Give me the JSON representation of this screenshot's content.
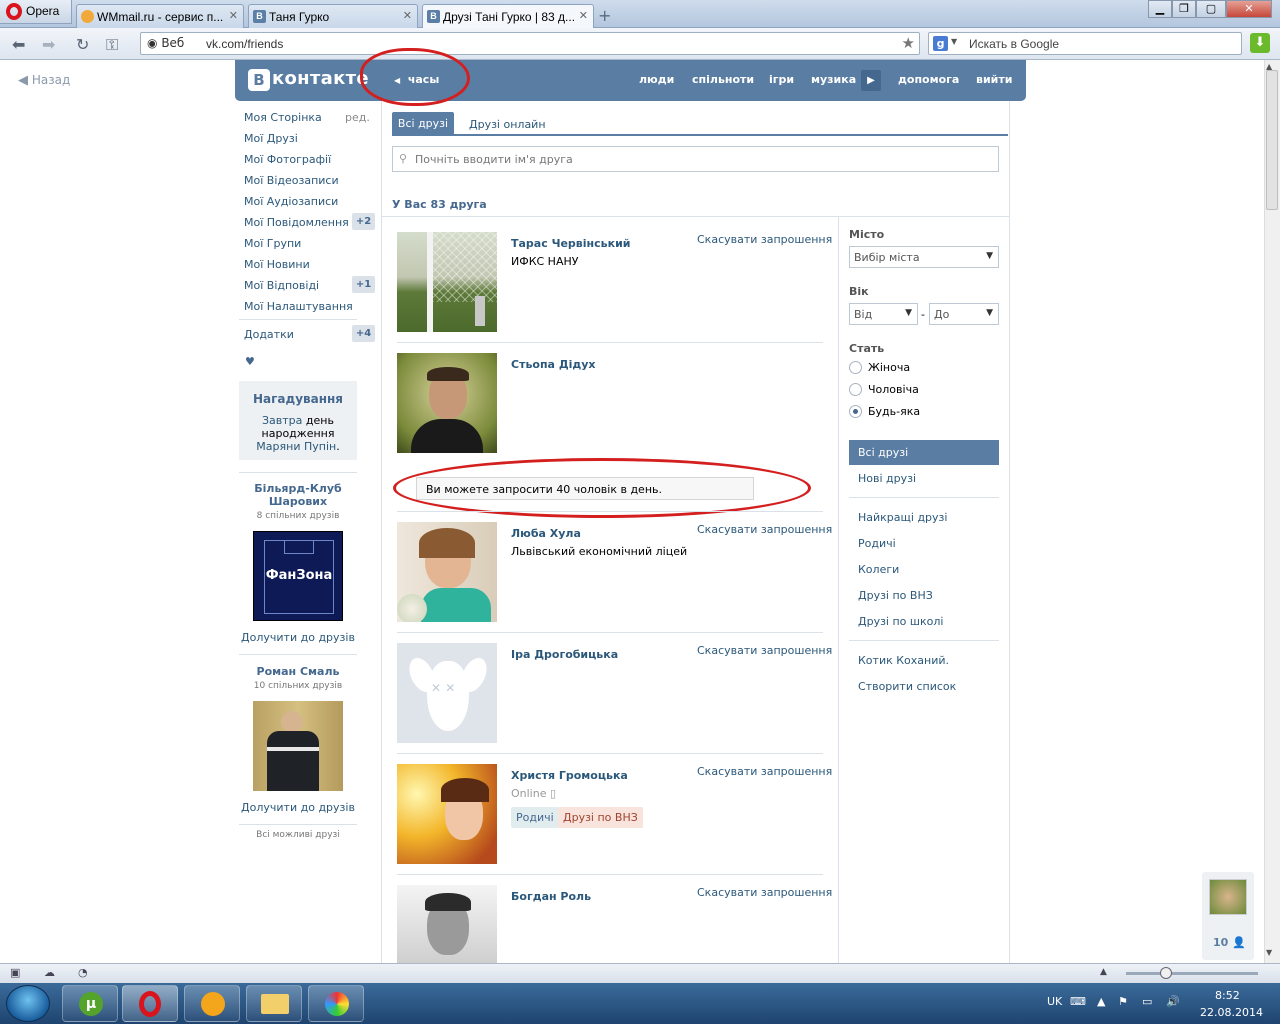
{
  "browser": {
    "menu_label": "Opera",
    "tabs": [
      {
        "label": "WMmail.ru - сервис п...",
        "active": false
      },
      {
        "label": "Таня Гурко",
        "active": false
      },
      {
        "label": "Друзі Тані Гурко | 83 д...",
        "active": true
      }
    ],
    "address_prefix": "Веб",
    "url": "vk.com/friends",
    "search_placeholder": "Искать в Google"
  },
  "page": {
    "back_label": "Назад",
    "logo_letter": "В",
    "logo_text": "контакте",
    "clock_label": "часы",
    "top_nav": [
      "люди",
      "спільноти",
      "ігри",
      "музика",
      "допомога",
      "вийти"
    ]
  },
  "left_menu": {
    "items": [
      {
        "label": "Моя Сторінка",
        "extra": "ред."
      },
      {
        "label": "Мої Друзі"
      },
      {
        "label": "Мої Фотографії"
      },
      {
        "label": "Мої Відеозаписи"
      },
      {
        "label": "Мої Аудіозаписи"
      },
      {
        "label": "Мої Повідомлення",
        "count": "+2"
      },
      {
        "label": "Мої Групи"
      },
      {
        "label": "Мої Новини"
      },
      {
        "label": "Мої Відповіді",
        "count": "+1"
      },
      {
        "label": "Мої Налаштування"
      }
    ],
    "apps_label": "Додатки",
    "apps_count": "+4",
    "heart": "♥",
    "reminder": {
      "title": "Нагадування",
      "word1": "Завтра",
      "word2": "день народження",
      "name": "Маряни Пупін",
      "dot": "."
    },
    "suggestions": [
      {
        "name": "Більярд-Клуб Шарових",
        "common": "8 спільних друзів",
        "action": "Долучити до друзів",
        "image_text": "ФанЗона"
      },
      {
        "name": "Роман Смаль",
        "common": "10 спільних друзів",
        "action": "Долучити до друзів"
      }
    ],
    "all_possible": "Всі можливі друзі"
  },
  "friends": {
    "tab_all": "Всі друзі",
    "tab_online": "Друзі онлайн",
    "search_placeholder": "Почніть вводити ім'я друга",
    "count_text": "У Вас 83 друга",
    "limit_message": "Ви можете запросити 40 чоловік в день.",
    "cancel_label": "Скасувати запрошення",
    "list": [
      {
        "name": "Тарас Червінський",
        "info": "ИФКС НАНУ"
      },
      {
        "name": "Стьопа Дідух",
        "info": ""
      },
      {
        "name": "Люба Хула",
        "info": "Львівський економічний ліцей"
      },
      {
        "name": "Іра Дрогобицька",
        "info": ""
      },
      {
        "name": "Христя Громоцька",
        "info": "",
        "status": "Online",
        "tags": [
          "Родичі",
          "Друзі по ВНЗ"
        ]
      },
      {
        "name": "Богдан Роль",
        "info": ""
      }
    ]
  },
  "filters": {
    "city_label": "Місто",
    "city_placeholder": "Вибір міста",
    "age_label": "Вік",
    "age_from": "Від",
    "age_sep": "-",
    "age_to": "До",
    "sex_label": "Стать",
    "sex_options": [
      "Жіноча",
      "Чоловіча",
      "Будь-яка"
    ],
    "sex_selected": "Будь-яка",
    "menu": [
      "Всі друзі",
      "Нові друзі",
      "Найкращі друзі",
      "Родичі",
      "Колеги",
      "Друзі по ВНЗ",
      "Друзі по школі",
      "Котик Коханий.",
      "Створити список"
    ],
    "menu_selected": "Всі друзі"
  },
  "side_widget": {
    "count": "10"
  },
  "taskbar": {
    "lang": "UK",
    "time": "8:52",
    "date": "22.08.2014"
  },
  "colors": {
    "vk_blue": "#597da3",
    "link": "#2b587a",
    "annotation_red": "#d41f1f"
  }
}
